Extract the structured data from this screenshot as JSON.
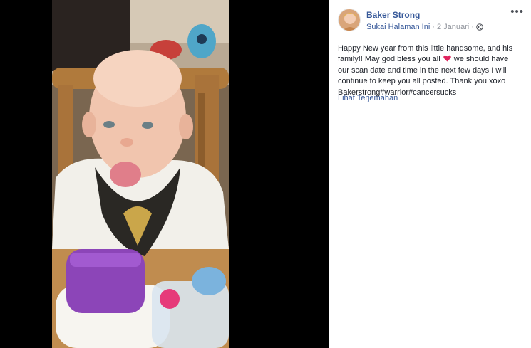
{
  "post": {
    "author": "Baker Strong",
    "like_page": "Sukai Halaman Ini",
    "separator": "·",
    "date": "2 Januari",
    "more_label": "•••",
    "text_lines": [
      "Happy New year from this little handsome, and his",
      "family!! May god bless you all",
      " we should have",
      "our scan date and time in the next few days I will",
      "continue to keep you all posted. Thank you xoxo",
      "Bakerstrong#warrior#cancersucks"
    ],
    "translate_link": "Lihat Terjemahan"
  },
  "icons": {
    "avatar": "profile-avatar",
    "privacy": "globe-icon",
    "emoji": "red-heart-icon",
    "options": "more-options-icon"
  },
  "colors": {
    "link": "#365899",
    "text": "#1d2129",
    "muted": "#90949c",
    "heart": "#e0245e",
    "viewer_bg": "#000000"
  }
}
